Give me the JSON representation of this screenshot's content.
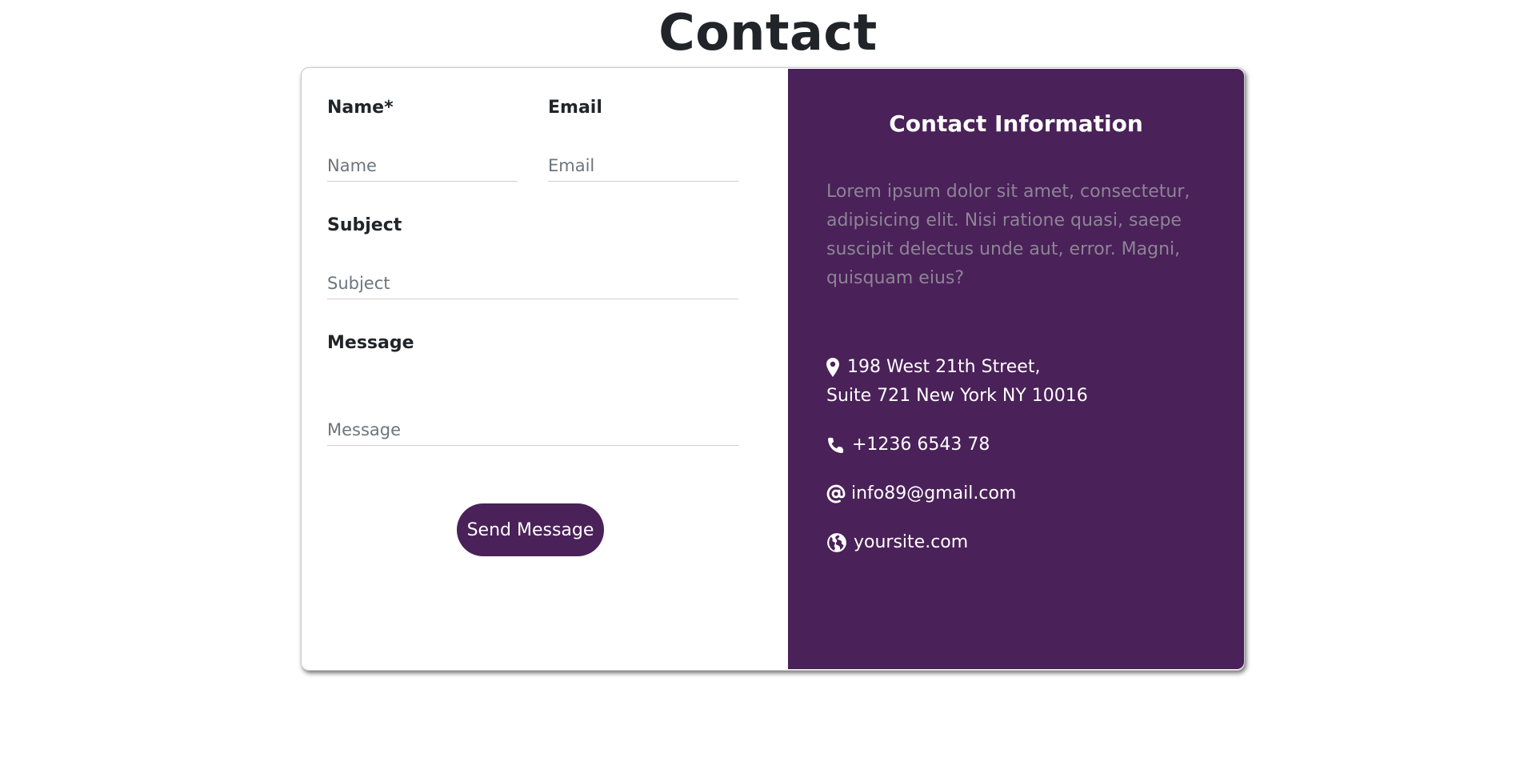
{
  "page": {
    "title": "Contact"
  },
  "form": {
    "name_label": "Name*",
    "name_placeholder": "Name",
    "email_label": "Email",
    "email_placeholder": "Email",
    "subject_label": "Subject",
    "subject_placeholder": "Subject",
    "message_label": "Message",
    "message_placeholder": "Message",
    "submit_label": "Send Message"
  },
  "info": {
    "title": "Contact Information",
    "description": "Lorem ipsum dolor sit amet, consectetur, adipisicing elit. Nisi ratione quasi, saepe suscipit delectus unde aut, error. Magni, quisquam eius?",
    "address_line1": "198 West 21th Street,",
    "address_line2": "Suite 721 New York NY 10016",
    "phone": "+1236 6543 78",
    "email": "info89@gmail.com",
    "website": "yoursite.com",
    "icons": [
      "map-marker-icon",
      "phone-icon",
      "at-sign-icon",
      "globe-icon"
    ]
  },
  "colors": {
    "accent": "#4a2158",
    "description_text": "#8d8496",
    "heading_text": "#212529"
  }
}
